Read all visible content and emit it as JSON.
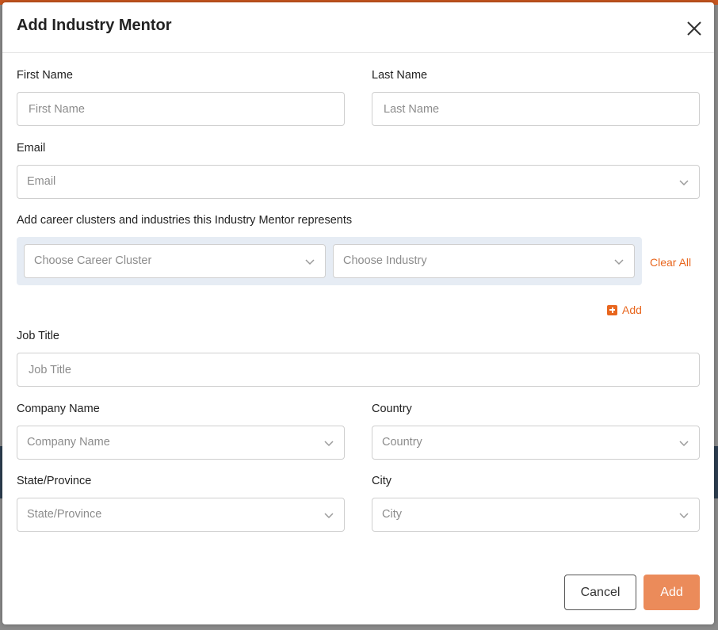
{
  "modal": {
    "title": "Add Industry Mentor"
  },
  "form": {
    "first_name": {
      "label": "First Name",
      "placeholder": "First Name",
      "value": ""
    },
    "last_name": {
      "label": "Last Name",
      "placeholder": "Last Name",
      "value": ""
    },
    "email": {
      "label": "Email",
      "placeholder": "Email"
    },
    "clusters": {
      "label": "Add career clusters and industries this Industry Mentor represents",
      "career_cluster_placeholder": "Choose Career Cluster",
      "industry_placeholder": "Choose Industry",
      "clear_all_label": "Clear All",
      "add_label": "Add"
    },
    "job_title": {
      "label": "Job Title",
      "placeholder": "Job Title",
      "value": ""
    },
    "company_name": {
      "label": "Company Name",
      "placeholder": "Company Name"
    },
    "country": {
      "label": "Country",
      "placeholder": "Country"
    },
    "state": {
      "label": "State/Province",
      "placeholder": "State/Province"
    },
    "city": {
      "label": "City",
      "placeholder": "City"
    }
  },
  "footer": {
    "cancel_label": "Cancel",
    "add_label": "Add"
  },
  "colors": {
    "accent": "#e8661e",
    "primary_button": "#eb8b5a",
    "cluster_bg": "#e6ecf4"
  },
  "icons": {
    "close": "close-icon",
    "dropdown": "chevron-down-icon",
    "add": "plus-square-icon"
  }
}
